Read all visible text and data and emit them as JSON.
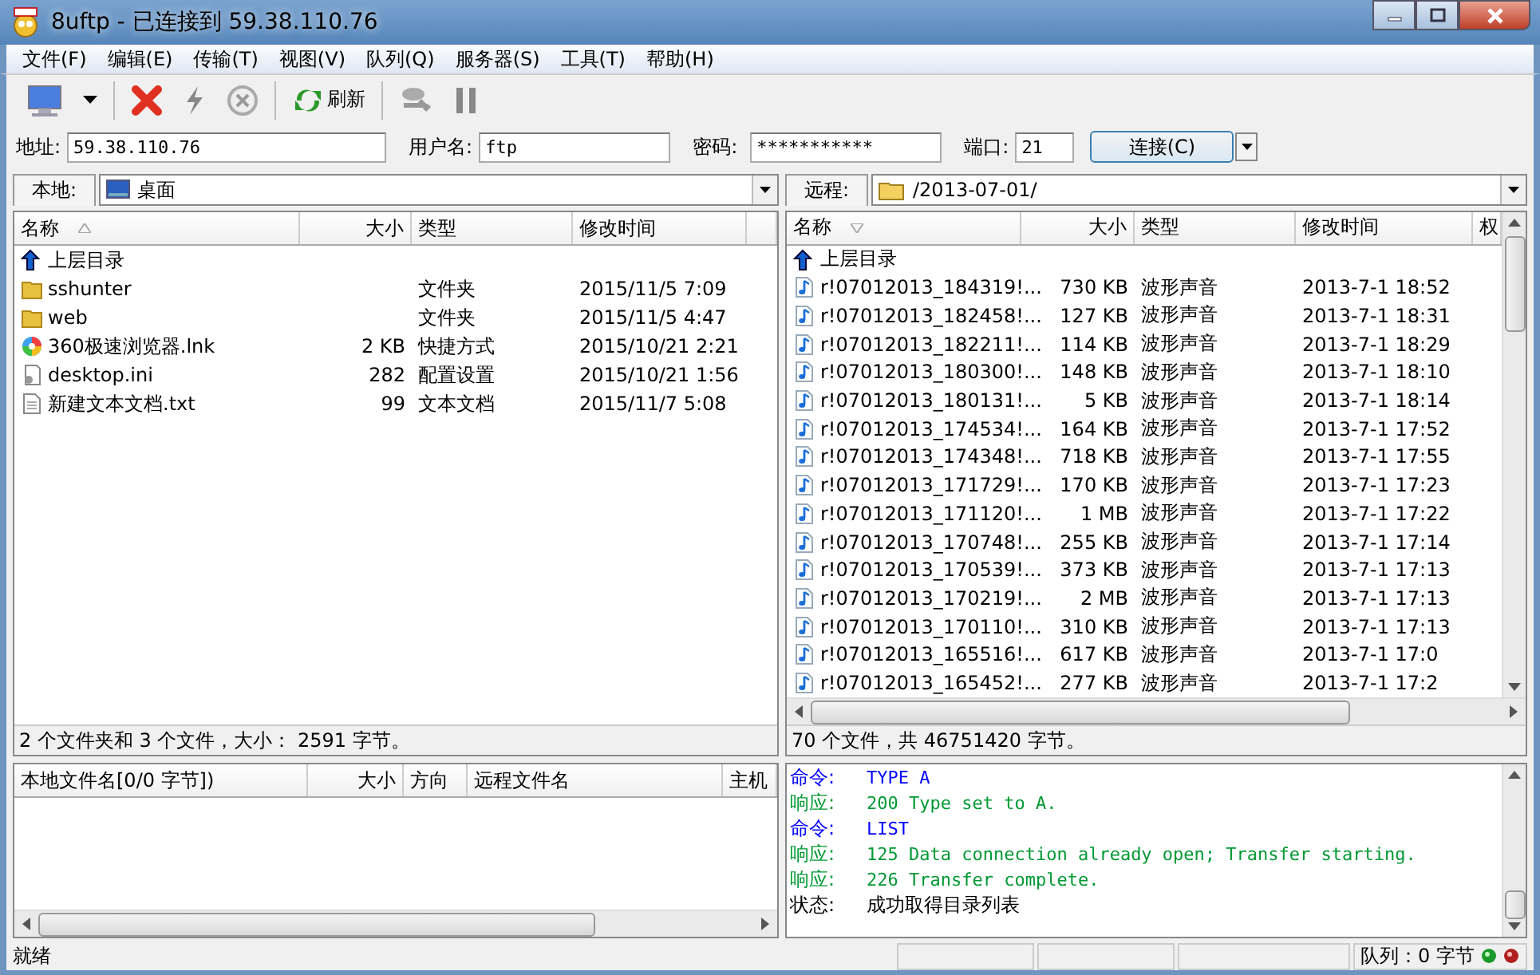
{
  "window": {
    "title": "8uftp - 已连接到 59.38.110.76"
  },
  "menu": [
    "文件(F)",
    "编辑(E)",
    "传输(T)",
    "视图(V)",
    "队列(Q)",
    "服务器(S)",
    "工具(T)",
    "帮助(H)"
  ],
  "toolbar": {
    "refresh_label": "刷新"
  },
  "connection": {
    "address_label": "地址:",
    "address": "59.38.110.76",
    "user_label": "用户名:",
    "user": "ftp",
    "password_label": "密码:",
    "password": "***********",
    "port_label": "端口:",
    "port": "21",
    "connect_button": "连接(C)"
  },
  "local": {
    "label": "本地:",
    "path": "桌面",
    "columns": [
      "名称",
      "大小",
      "类型",
      "修改时间"
    ],
    "rows": [
      {
        "kind": "up",
        "name": "上层目录"
      },
      {
        "kind": "folder",
        "name": "sshunter",
        "type": "文件夹",
        "modified": "2015/11/5 7:09"
      },
      {
        "kind": "folder",
        "name": "web",
        "type": "文件夹",
        "modified": "2015/11/5 4:47"
      },
      {
        "kind": "browser",
        "name": "360极速浏览器.lnk",
        "size": "2 KB",
        "type": "快捷方式",
        "modified": "2015/10/21 2:21"
      },
      {
        "kind": "config",
        "name": "desktop.ini",
        "size": "282",
        "type": "配置设置",
        "modified": "2015/10/21 1:56"
      },
      {
        "kind": "text",
        "name": "新建文本文档.txt",
        "size": "99",
        "type": "文本文档",
        "modified": "2015/11/7 5:08"
      }
    ],
    "summary": "2 个文件夹和 3 个文件，大小： 2591 字节。"
  },
  "remote": {
    "label": "远程:",
    "path": "/2013-07-01/",
    "columns": [
      "名称",
      "大小",
      "类型",
      "修改时间",
      "权"
    ],
    "rows": [
      {
        "kind": "up",
        "name": "上层目录"
      },
      {
        "kind": "audio",
        "name": "r!07012013_184319!...",
        "size": "730 KB",
        "type": "波形声音",
        "modified": "2013-7-1 18:52"
      },
      {
        "kind": "audio",
        "name": "r!07012013_182458!...",
        "size": "127 KB",
        "type": "波形声音",
        "modified": "2013-7-1 18:31"
      },
      {
        "kind": "audio",
        "name": "r!07012013_182211!...",
        "size": "114 KB",
        "type": "波形声音",
        "modified": "2013-7-1 18:29"
      },
      {
        "kind": "audio",
        "name": "r!07012013_180300!...",
        "size": "148 KB",
        "type": "波形声音",
        "modified": "2013-7-1 18:10"
      },
      {
        "kind": "audio",
        "name": "r!07012013_180131!...",
        "size": "5 KB",
        "type": "波形声音",
        "modified": "2013-7-1 18:14"
      },
      {
        "kind": "audio",
        "name": "r!07012013_174534!...",
        "size": "164 KB",
        "type": "波形声音",
        "modified": "2013-7-1 17:52"
      },
      {
        "kind": "audio",
        "name": "r!07012013_174348!...",
        "size": "718 KB",
        "type": "波形声音",
        "modified": "2013-7-1 17:55"
      },
      {
        "kind": "audio",
        "name": "r!07012013_171729!...",
        "size": "170 KB",
        "type": "波形声音",
        "modified": "2013-7-1 17:23"
      },
      {
        "kind": "audio",
        "name": "r!07012013_171120!...",
        "size": "1 MB",
        "type": "波形声音",
        "modified": "2013-7-1 17:22"
      },
      {
        "kind": "audio",
        "name": "r!07012013_170748!...",
        "size": "255 KB",
        "type": "波形声音",
        "modified": "2013-7-1 17:14"
      },
      {
        "kind": "audio",
        "name": "r!07012013_170539!...",
        "size": "373 KB",
        "type": "波形声音",
        "modified": "2013-7-1 17:13"
      },
      {
        "kind": "audio",
        "name": "r!07012013_170219!...",
        "size": "2 MB",
        "type": "波形声音",
        "modified": "2013-7-1 17:13"
      },
      {
        "kind": "audio",
        "name": "r!07012013_170110!...",
        "size": "310 KB",
        "type": "波形声音",
        "modified": "2013-7-1 17:13"
      },
      {
        "kind": "audio",
        "name": "r!07012013_165516!...",
        "size": "617 KB",
        "type": "波形声音",
        "modified": "2013-7-1 17:0"
      },
      {
        "kind": "audio",
        "name": "r!07012013_165452!...",
        "size": "277 KB",
        "type": "波形声音",
        "modified": "2013-7-1 17:2"
      }
    ],
    "summary": "70 个文件，共 46751420 字节。"
  },
  "queue": {
    "columns": [
      "本地文件名[0/0 字节])",
      "大小",
      "方向",
      "远程文件名",
      "主机"
    ]
  },
  "log": [
    {
      "kind": "command",
      "label": "命令:",
      "text": "TYPE A"
    },
    {
      "kind": "response",
      "label": "响应:",
      "text": "200 Type set to A."
    },
    {
      "kind": "command",
      "label": "命令:",
      "text": "LIST"
    },
    {
      "kind": "response",
      "label": "响应:",
      "text": "125 Data connection already open; Transfer starting."
    },
    {
      "kind": "response",
      "label": "响应:",
      "text": "226 Transfer complete."
    },
    {
      "kind": "status",
      "label": "状态:",
      "text": "成功取得目录列表"
    }
  ],
  "status_bar": {
    "text": "就绪",
    "queue": "队列：0 字节"
  }
}
